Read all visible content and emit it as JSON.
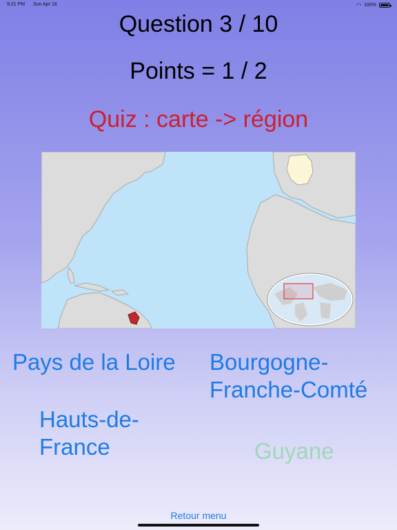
{
  "status_bar": {
    "time": "9:21 PM",
    "date": "Sun Apr 18",
    "battery": "100%"
  },
  "header": {
    "question": "Question 3 / 10",
    "points": "Points = 1 / 2",
    "quiz_mode": "Quiz : carte -> région"
  },
  "answers": [
    {
      "label": "Pays de la Loire"
    },
    {
      "label": "Bourgogne-Franche-Comté"
    },
    {
      "label": "Hauts-de-France"
    },
    {
      "label": "Guyane"
    }
  ],
  "footer": {
    "back_label": "Retour menu"
  },
  "colors": {
    "highlight_region": "#c0282f",
    "accent": "#1e7be6",
    "mode_title": "#cc1f2f",
    "dimmed_answer": "#9fd8b6"
  }
}
